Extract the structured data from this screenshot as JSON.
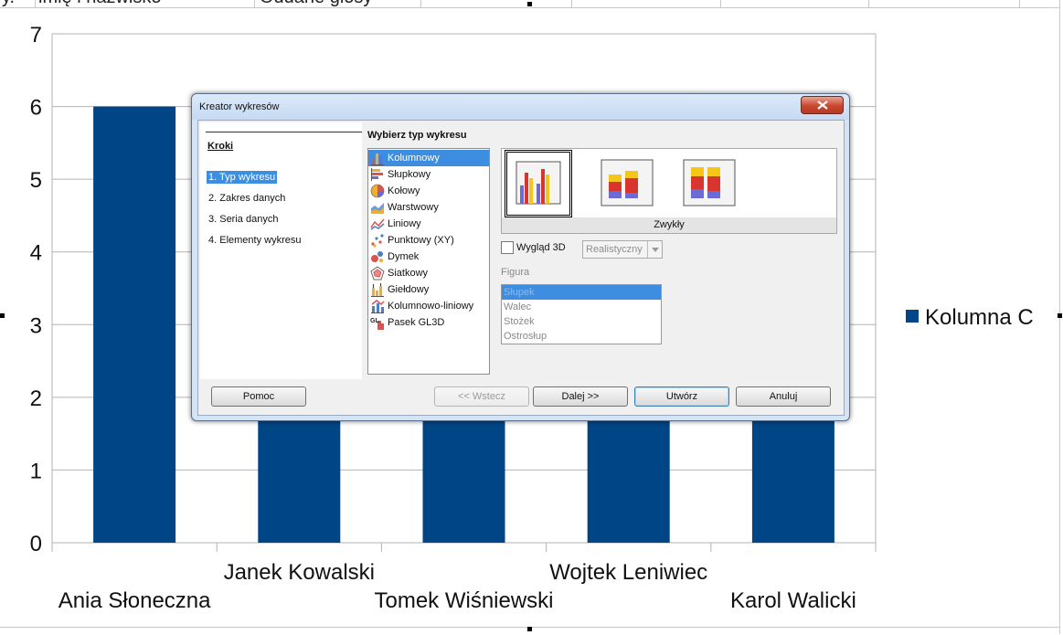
{
  "sheet": {
    "top_cells": [
      "imię i nazwisko",
      "Oddane głosy"
    ],
    "top_prefix": "y."
  },
  "chart_data": {
    "type": "bar",
    "categories": [
      "Ania Słoneczna",
      "Janek Kowalski",
      "Tomek Wiśniewski",
      "Wojtek Leniwiec",
      "Karol Walicki"
    ],
    "series": [
      {
        "name": "Kolumna C",
        "values": [
          6,
          3,
          2,
          4,
          3
        ]
      }
    ],
    "ylim": [
      0,
      7
    ],
    "yticks": [
      "0",
      "1",
      "2",
      "3",
      "4",
      "5",
      "6",
      "7"
    ],
    "grid": true,
    "legend": "right",
    "colors": {
      "bar": "#004586",
      "grid": "#b3b3b3"
    }
  },
  "dialog": {
    "title": "Kreator wykresów",
    "steps_title": "Kroki",
    "steps": [
      "1. Typ wykresu",
      "2. Zakres danych",
      "3. Seria danych",
      "4. Elementy wykresu"
    ],
    "section_label": "Wybierz typ wykresu",
    "chart_types": [
      {
        "label": "Kolumnowy",
        "icon": "column-chart-icon"
      },
      {
        "label": "Słupkowy",
        "icon": "bar-chart-icon"
      },
      {
        "label": "Kołowy",
        "icon": "pie-chart-icon"
      },
      {
        "label": "Warstwowy",
        "icon": "area-chart-icon"
      },
      {
        "label": "Liniowy",
        "icon": "line-chart-icon"
      },
      {
        "label": "Punktowy (XY)",
        "icon": "scatter-chart-icon"
      },
      {
        "label": "Dymek",
        "icon": "bubble-chart-icon"
      },
      {
        "label": "Siatkowy",
        "icon": "net-chart-icon"
      },
      {
        "label": "Giełdowy",
        "icon": "stock-chart-icon"
      },
      {
        "label": "Kolumnowo-liniowy",
        "icon": "column-line-chart-icon"
      },
      {
        "label": "Pasek GL3D",
        "icon": "gl3d-chart-icon"
      }
    ],
    "variant_caption": "Zwykły",
    "look3d_label": "Wygląd 3D",
    "look3d_value": "Realistyczny",
    "figure_label": "Figura",
    "figures": [
      "Słupek",
      "Walec",
      "Stożek",
      "Ostrosłup"
    ],
    "buttons": {
      "help": "Pomoc",
      "back": "<< Wstecz",
      "next": "Dalej >>",
      "create": "Utwórz",
      "cancel": "Anuluj"
    },
    "colors": {
      "selection": "#3d8ee0",
      "close": "#c9462f"
    }
  }
}
